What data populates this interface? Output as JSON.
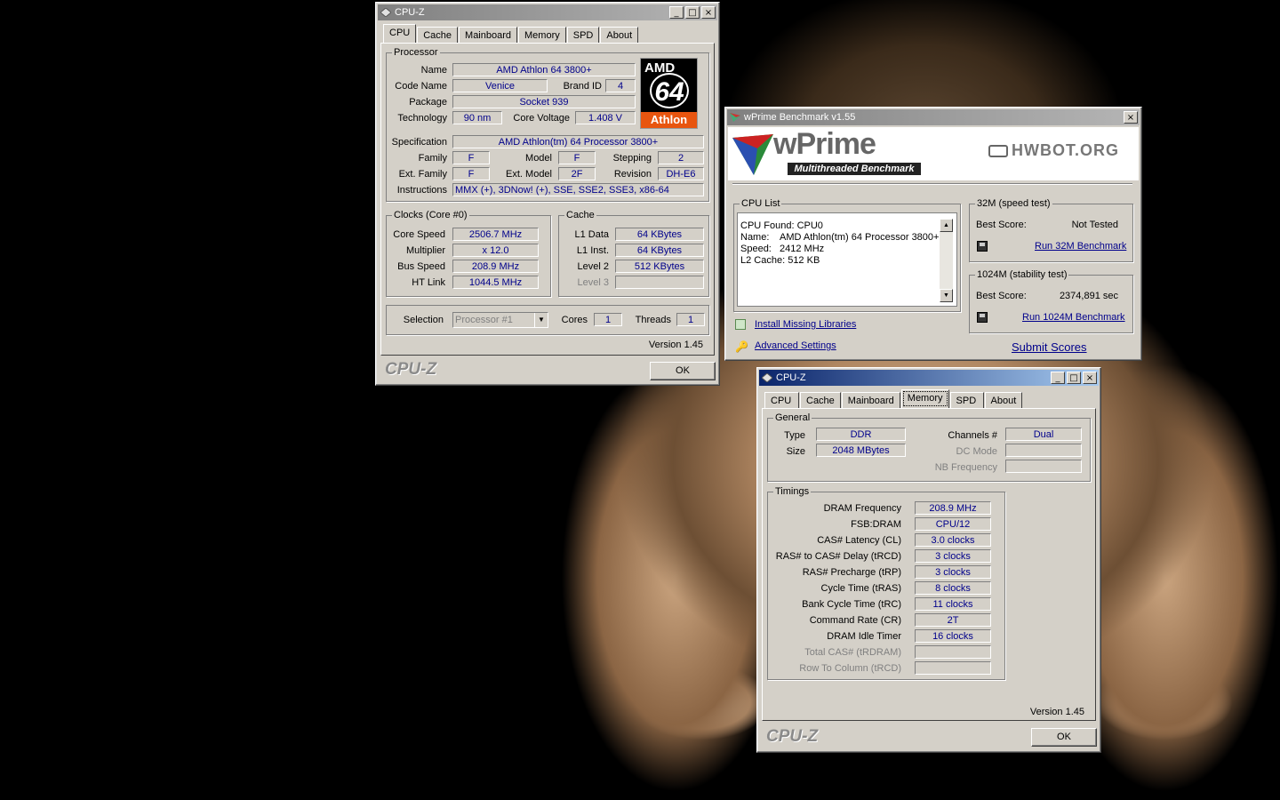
{
  "cpuz_main": {
    "title": "CPU-Z",
    "tabs": [
      "CPU",
      "Cache",
      "Mainboard",
      "Memory",
      "SPD",
      "About"
    ],
    "processor": {
      "group_title": "Processor",
      "name_label": "Name",
      "name": "AMD Athlon 64 3800+",
      "codename_label": "Code Name",
      "codename": "Venice",
      "brandid_label": "Brand ID",
      "brandid": "4",
      "package_label": "Package",
      "package": "Socket 939",
      "technology_label": "Technology",
      "technology": "90 nm",
      "corevoltage_label": "Core Voltage",
      "corevoltage": "1.408 V",
      "spec_label": "Specification",
      "spec": "AMD Athlon(tm) 64 Processor 3800+",
      "family_label": "Family",
      "family": "F",
      "model_label": "Model",
      "model": "F",
      "stepping_label": "Stepping",
      "stepping": "2",
      "extfamily_label": "Ext. Family",
      "extfamily": "F",
      "extmodel_label": "Ext. Model",
      "extmodel": "2F",
      "revision_label": "Revision",
      "revision": "DH-E6",
      "instructions_label": "Instructions",
      "instructions": "MMX (+), 3DNow! (+), SSE, SSE2, SSE3, x86-64",
      "logo_top": "AMD",
      "logo_num": "64",
      "logo_bottom": "Athlon"
    },
    "clocks": {
      "group_title": "Clocks (Core #0)",
      "corespeed_label": "Core Speed",
      "corespeed": "2506.7 MHz",
      "multiplier_label": "Multiplier",
      "multiplier": "x 12.0",
      "busspeed_label": "Bus Speed",
      "busspeed": "208.9 MHz",
      "htlink_label": "HT Link",
      "htlink": "1044.5 MHz"
    },
    "cache": {
      "group_title": "Cache",
      "l1data_label": "L1 Data",
      "l1data": "64 KBytes",
      "l1inst_label": "L1 Inst.",
      "l1inst": "64 KBytes",
      "level2_label": "Level 2",
      "level2": "512 KBytes",
      "level3_label": "Level 3",
      "level3": ""
    },
    "selection_label": "Selection",
    "selection": "Processor #1",
    "cores_label": "Cores",
    "cores": "1",
    "threads_label": "Threads",
    "threads": "1",
    "version": "Version 1.45",
    "brand": "CPU-Z",
    "ok": "OK"
  },
  "wprime": {
    "title": "wPrime Benchmark v1.55",
    "logo": "wPrime",
    "tagline": "Multithreaded Benchmark",
    "hwbot": "HWBOT.ORG",
    "cpu_list_title": "CPU List",
    "cpu_list_lines": [
      "CPU Found: CPU0",
      "Name:    AMD Athlon(tm) 64 Processor 3800+",
      "Speed:   2412 MHz",
      "L2 Cache: 512 KB"
    ],
    "test32_title": "32M (speed test)",
    "test32_best_label": "Best Score:",
    "test32_best": "Not Tested",
    "test32_run": "Run 32M Benchmark",
    "test1024_title": "1024M (stability test)",
    "test1024_best_label": "Best Score:",
    "test1024_best": "2374,891 sec",
    "test1024_run": "Run 1024M Benchmark",
    "install_libs": "Install Missing Libraries",
    "advanced": "Advanced Settings",
    "submit": "Submit Scores"
  },
  "cpuz_mem": {
    "title": "CPU-Z",
    "tabs": [
      "CPU",
      "Cache",
      "Mainboard",
      "Memory",
      "SPD",
      "About"
    ],
    "general_title": "General",
    "type_label": "Type",
    "type": "DDR",
    "size_label": "Size",
    "size": "2048 MBytes",
    "channels_label": "Channels #",
    "channels": "Dual",
    "dcmode_label": "DC Mode",
    "dcmode": "",
    "nbfreq_label": "NB Frequency",
    "nbfreq": "",
    "timings_title": "Timings",
    "timings": [
      {
        "label": "DRAM Frequency",
        "value": "208.9 MHz",
        "dis": false
      },
      {
        "label": "FSB:DRAM",
        "value": "CPU/12",
        "dis": false
      },
      {
        "label": "CAS# Latency (CL)",
        "value": "3.0 clocks",
        "dis": false
      },
      {
        "label": "RAS# to CAS# Delay (tRCD)",
        "value": "3 clocks",
        "dis": false
      },
      {
        "label": "RAS# Precharge (tRP)",
        "value": "3 clocks",
        "dis": false
      },
      {
        "label": "Cycle Time (tRAS)",
        "value": "8 clocks",
        "dis": false
      },
      {
        "label": "Bank Cycle Time (tRC)",
        "value": "11 clocks",
        "dis": false
      },
      {
        "label": "Command Rate (CR)",
        "value": "2T",
        "dis": false
      },
      {
        "label": "DRAM Idle Timer",
        "value": "16 clocks",
        "dis": false
      },
      {
        "label": "Total CAS# (tRDRAM)",
        "value": "",
        "dis": true
      },
      {
        "label": "Row To Column (tRCD)",
        "value": "",
        "dis": true
      }
    ],
    "version": "Version 1.45",
    "brand": "CPU-Z",
    "ok": "OK"
  }
}
